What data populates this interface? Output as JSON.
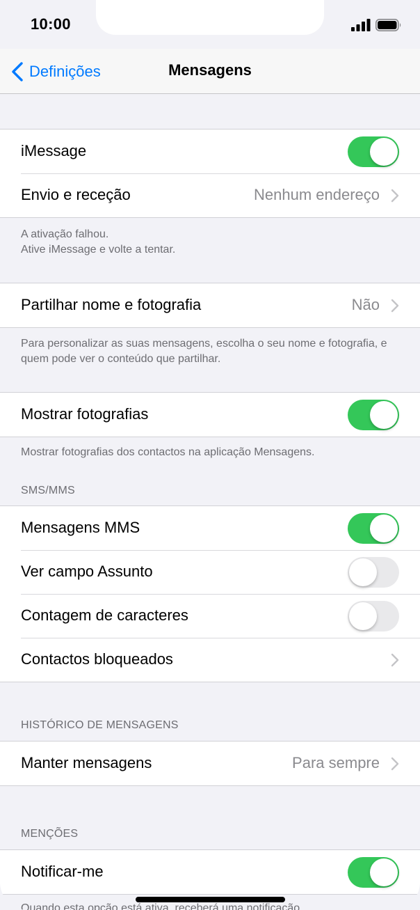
{
  "status": {
    "time": "10:00"
  },
  "nav": {
    "back_label": "Definições",
    "title": "Mensagens"
  },
  "group1": {
    "imessage": {
      "label": "iMessage",
      "on": true
    },
    "send_receive": {
      "label": "Envio e receção",
      "value": "Nenhum endereço"
    }
  },
  "note1": {
    "line1": "A ativação falhou.",
    "line2": "Ative iMessage e volte a tentar."
  },
  "group2": {
    "share": {
      "label": "Partilhar nome e fotografia",
      "value": "Não"
    }
  },
  "note2": {
    "text": "Para personalizar as suas mensagens, escolha o seu nome e fotografia, e quem pode ver o conteúdo que partilhar."
  },
  "group3": {
    "show_photos": {
      "label": "Mostrar fotografias",
      "on": true
    }
  },
  "note3": {
    "text": "Mostrar fotografias dos contactos na aplicação Mensagens."
  },
  "sms_header": "SMS/MMS",
  "group4": {
    "mms": {
      "label": "Mensagens MMS",
      "on": true
    },
    "subject": {
      "label": "Ver campo Assunto",
      "on": false
    },
    "char_count": {
      "label": "Contagem de caracteres",
      "on": false
    },
    "blocked": {
      "label": "Contactos bloqueados"
    }
  },
  "history_header": "HISTÓRICO DE MENSAGENS",
  "group5": {
    "keep": {
      "label": "Manter mensagens",
      "value": "Para sempre"
    }
  },
  "mentions_header": "MENÇÕES",
  "group6": {
    "notify": {
      "label": "Notificar-me",
      "on": true
    }
  },
  "note6": {
    "text": "Quando esta opção está ativa, receberá uma notificação"
  },
  "colors": {
    "accent": "#007aff",
    "toggle_on": "#34c759",
    "toggle_off": "#e9e9eb"
  }
}
